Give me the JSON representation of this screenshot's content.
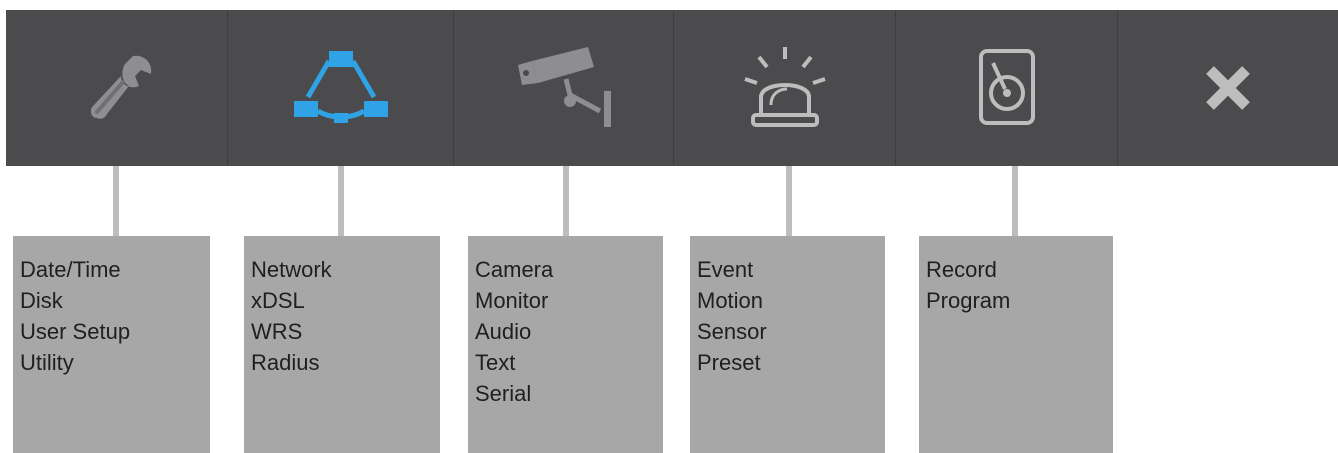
{
  "toolbar": {
    "buttons": [
      {
        "icon": "wrench-icon",
        "color": "#8e8e90"
      },
      {
        "icon": "network-icon",
        "color": "#2fa3e6"
      },
      {
        "icon": "camera-icon",
        "color": "#8e8e90"
      },
      {
        "icon": "alarm-icon",
        "color": "#8e8e90"
      },
      {
        "icon": "hard-disk-icon",
        "color": "#8e8e90"
      },
      {
        "icon": "close-icon",
        "color": "#8e8e90"
      }
    ]
  },
  "menus": {
    "system": [
      "Date/Time",
      "Disk",
      "User Setup",
      "Utility"
    ],
    "network": [
      "Network",
      "xDSL",
      "WRS",
      "Radius"
    ],
    "device": [
      "Camera",
      "Monitor",
      "Audio",
      "Text",
      "Serial"
    ],
    "event": [
      "Event",
      "Motion",
      "Sensor",
      "Preset"
    ],
    "record": [
      "Record",
      "Program"
    ]
  },
  "colors": {
    "toolbar_bg": "#4b4b4d",
    "menu_bg": "#a7a7a7",
    "connector": "#bdbdbd",
    "active_icon": "#2fa3e6"
  }
}
